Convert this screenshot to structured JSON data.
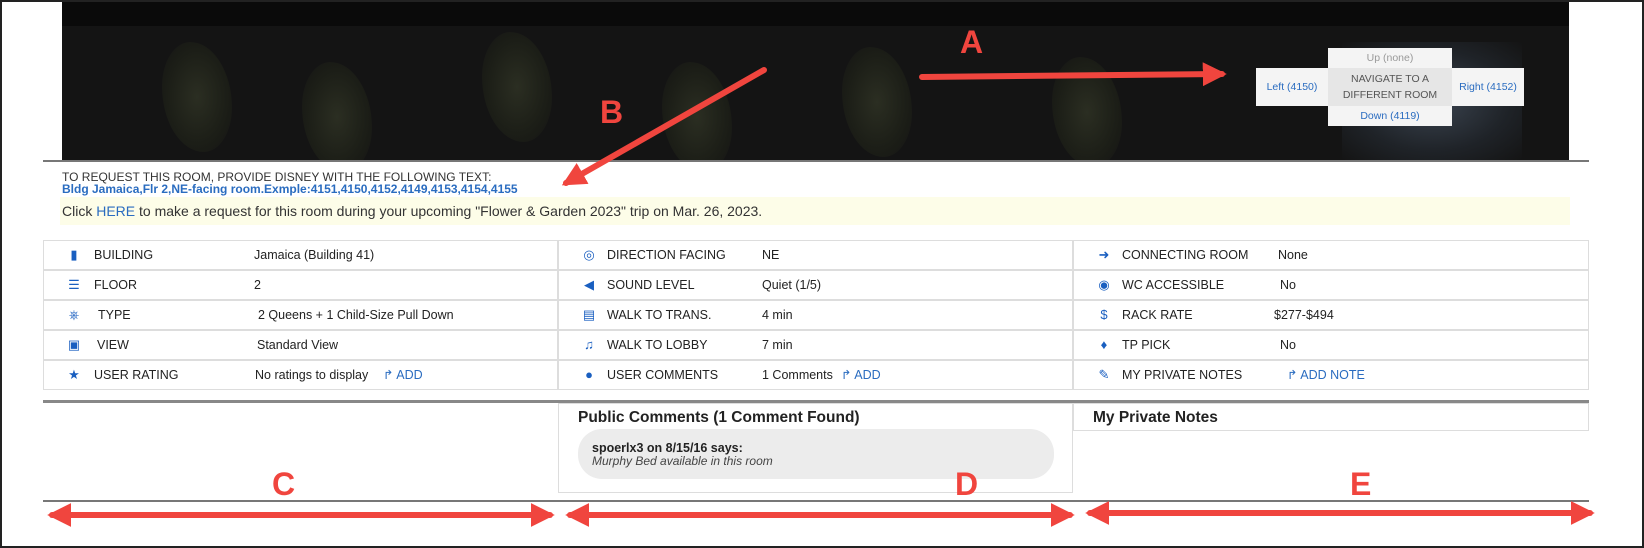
{
  "navigation": {
    "up": "Up (none)",
    "down": "Down (4119)",
    "left": "Left (4150)",
    "right": "Right (4152)",
    "center": "NAVIGATE TO A DIFFERENT ROOM"
  },
  "request": {
    "label": "TO REQUEST THIS ROOM, PROVIDE DISNEY WITH THE FOLLOWING TEXT:",
    "text": "Bldg Jamaica,Flr 2,NE-facing room.Exmple:4151,4150,4152,4149,4153,4154,4155",
    "click_prefix": "Click ",
    "click_link": "HERE",
    "click_suffix": " to make a request for this room during your upcoming \"Flower & Garden 2023\" trip on Mar. 26, 2023."
  },
  "details": {
    "col1": [
      {
        "icon": "building-icon",
        "label": "BUILDING",
        "value": "Jamaica (Building 41)"
      },
      {
        "icon": "floor-icon",
        "label": "FLOOR",
        "value": "2"
      },
      {
        "icon": "bed-icon",
        "label": "TYPE",
        "value": "2 Queens + 1 Child-Size Pull Down"
      },
      {
        "icon": "image-icon",
        "label": "VIEW",
        "value": "Standard View"
      },
      {
        "icon": "star-icon",
        "label": "USER RATING",
        "value": "No ratings to display",
        "action": "ADD"
      }
    ],
    "col2": [
      {
        "icon": "compass-icon",
        "label": "DIRECTION FACING",
        "value": "NE"
      },
      {
        "icon": "megaphone-icon",
        "label": "SOUND LEVEL",
        "value": "Quiet (1/5)"
      },
      {
        "icon": "bus-icon",
        "label": "WALK TO TRANS.",
        "value": "4 min"
      },
      {
        "icon": "bell-icon",
        "label": "WALK TO LOBBY",
        "value": "7 min"
      },
      {
        "icon": "comments-icon",
        "label": "USER COMMENTS",
        "value": "1 Comments",
        "action": "ADD"
      }
    ],
    "col3": [
      {
        "icon": "sign-in-icon",
        "label": "CONNECTING ROOM",
        "value": "None"
      },
      {
        "icon": "accessibility-icon",
        "label": "WC ACCESSIBLE",
        "value": "No"
      },
      {
        "icon": "dollar-icon",
        "label": "RACK RATE",
        "value": "$277-$494"
      },
      {
        "icon": "thumbs-up-icon",
        "label": "TP PICK",
        "value": "No"
      },
      {
        "icon": "pencil-icon",
        "label": "MY PRIVATE NOTES",
        "action": "ADD NOTE"
      }
    ]
  },
  "public_comments": {
    "title": "Public Comments (1 Comment Found)",
    "user_line": "spoerlx3 on 8/15/16 says:",
    "text": "Murphy Bed available in this room"
  },
  "private_notes": {
    "title": "My Private Notes"
  },
  "annotations": {
    "a": "A",
    "b": "B",
    "c": "C",
    "d": "D",
    "e": "E",
    "color": "#f0453e"
  }
}
